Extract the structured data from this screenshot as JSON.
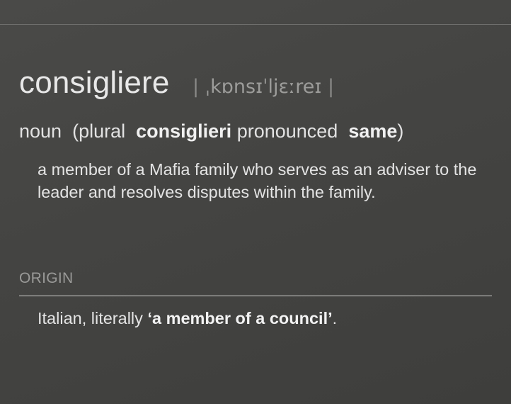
{
  "entry": {
    "headword": "consigliere",
    "pronunciation": "ˌkɒnsɪˈljɛːreɪ",
    "pron_bar": "|",
    "part_of_speech": "noun",
    "plural_open": "(plural",
    "plural_form": "consiglieri",
    "pronounced_word": "pronounced",
    "pronounced_value": "same",
    "plural_close": ")",
    "definition": "a member of a Mafia family who serves as an adviser to the leader and resolves disputes within the family."
  },
  "origin": {
    "label": "ORIGIN",
    "prefix": "Italian, literally",
    "quote": "‘a member of a council’",
    "suffix": "."
  }
}
